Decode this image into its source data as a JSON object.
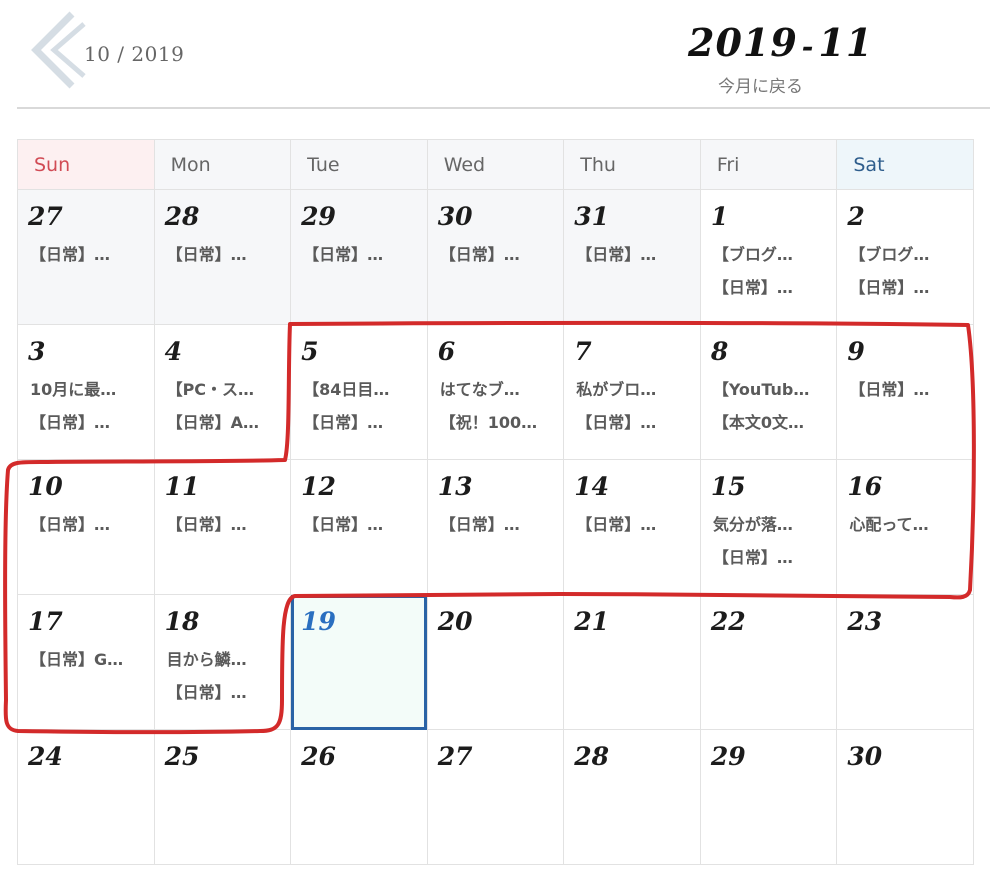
{
  "header": {
    "prev_label": "10 / 2019",
    "title_year": "2019",
    "title_sep": "-",
    "title_month": "11",
    "back_to_today": "今月に戻る"
  },
  "weekdays": [
    "Sun",
    "Mon",
    "Tue",
    "Wed",
    "Thu",
    "Fri",
    "Sat"
  ],
  "weeks": [
    [
      {
        "day": "27",
        "posts": [
          "【日常】…"
        ],
        "other": true
      },
      {
        "day": "28",
        "posts": [
          "【日常】…"
        ],
        "other": true
      },
      {
        "day": "29",
        "posts": [
          "【日常】…"
        ],
        "other": true
      },
      {
        "day": "30",
        "posts": [
          "【日常】…"
        ],
        "other": true
      },
      {
        "day": "31",
        "posts": [
          "【日常】…"
        ],
        "other": true
      },
      {
        "day": "1",
        "posts": [
          "【ブログ…",
          "【日常】…"
        ]
      },
      {
        "day": "2",
        "posts": [
          "【ブログ…",
          "【日常】…"
        ]
      }
    ],
    [
      {
        "day": "3",
        "posts": [
          "10月に最…",
          "【日常】…"
        ]
      },
      {
        "day": "4",
        "posts": [
          "【PC・ス…",
          "【日常】A…"
        ]
      },
      {
        "day": "5",
        "posts": [
          "【84日目…",
          "【日常】…"
        ]
      },
      {
        "day": "6",
        "posts": [
          "はてなブ…",
          "【祝！100…"
        ]
      },
      {
        "day": "7",
        "posts": [
          "私がブロ…",
          "【日常】…"
        ]
      },
      {
        "day": "8",
        "posts": [
          "【YouTub…",
          "【本文0文…"
        ]
      },
      {
        "day": "9",
        "posts": [
          "【日常】…"
        ]
      }
    ],
    [
      {
        "day": "10",
        "posts": [
          "【日常】…"
        ]
      },
      {
        "day": "11",
        "posts": [
          "【日常】…"
        ]
      },
      {
        "day": "12",
        "posts": [
          "【日常】…"
        ]
      },
      {
        "day": "13",
        "posts": [
          "【日常】…"
        ]
      },
      {
        "day": "14",
        "posts": [
          "【日常】…"
        ]
      },
      {
        "day": "15",
        "posts": [
          "気分が落…",
          "【日常】…"
        ]
      },
      {
        "day": "16",
        "posts": [
          "心配って…"
        ]
      }
    ],
    [
      {
        "day": "17",
        "posts": [
          "【日常】G…"
        ]
      },
      {
        "day": "18",
        "posts": [
          "目から鱗…",
          "【日常】…"
        ]
      },
      {
        "day": "19",
        "posts": [],
        "today": true
      },
      {
        "day": "20",
        "posts": []
      },
      {
        "day": "21",
        "posts": []
      },
      {
        "day": "22",
        "posts": []
      },
      {
        "day": "23",
        "posts": []
      }
    ],
    [
      {
        "day": "24",
        "posts": []
      },
      {
        "day": "25",
        "posts": []
      },
      {
        "day": "26",
        "posts": []
      },
      {
        "day": "27",
        "posts": []
      },
      {
        "day": "28",
        "posts": []
      },
      {
        "day": "29",
        "posts": []
      },
      {
        "day": "30",
        "posts": []
      }
    ]
  ],
  "colors": {
    "annotation": "#d32a2a",
    "today_border": "#2a63a6",
    "sunday": "#d14b55",
    "saturday": "#2e5d8c"
  }
}
